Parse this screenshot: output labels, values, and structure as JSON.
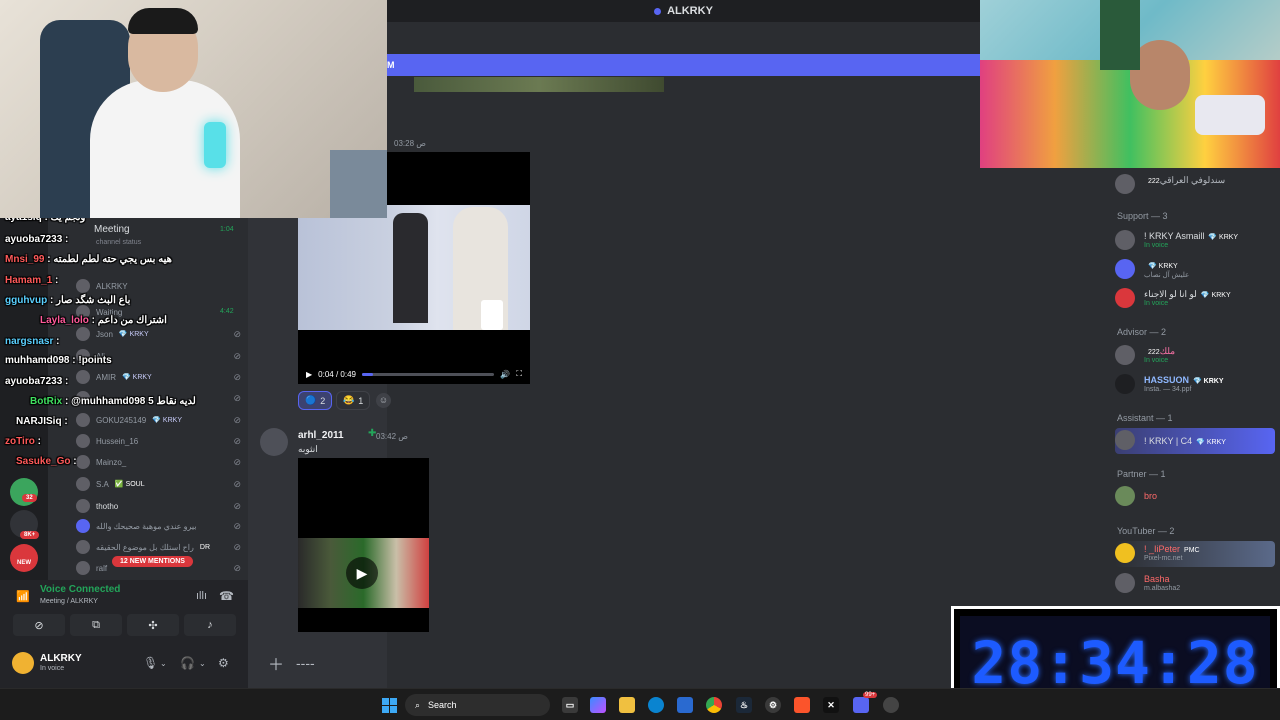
{
  "window": {
    "title": "ALKRKY"
  },
  "chat": {
    "banner_text": "M",
    "timestamp1": "03:28 ص",
    "video": {
      "time": "0:04 / 0:49",
      "progress": 0.08
    },
    "reactions": [
      {
        "emoji": "🔵",
        "count": "2",
        "active": true
      },
      {
        "emoji": "😂",
        "count": "1",
        "active": false
      }
    ],
    "message2": {
      "author": "arhl_2011",
      "timestamp": "03:42 ص",
      "text": "انثوبه"
    },
    "composer_placeholder": "----"
  },
  "sidebar": {
    "channel_title": "Meeting",
    "channel_status": "channel status",
    "channel_time": "1:04",
    "items": [
      {
        "name": "ALKRKY",
        "tag": ""
      },
      {
        "name": "Waiting",
        "tag": "",
        "time": "4:42"
      },
      {
        "name": "Json",
        "tag": "💎 KRKY"
      },
      {
        "name": "Ali",
        "tag": ""
      },
      {
        "name": "AMIR",
        "tag": "💎 KRKY"
      },
      {
        "name": "GOKU245149",
        "tag": "💎 KRKY"
      },
      {
        "name": "Hussein_16",
        "tag": ""
      },
      {
        "name": "Mainzo_",
        "tag": ""
      },
      {
        "name": "S.A",
        "tag": "✅ SOUL"
      },
      {
        "name": "thotho",
        "tag": ""
      },
      {
        "name": "بيرو عندي موهبة صحيحك والله",
        "tag": ""
      },
      {
        "name": "راح استلك بل موضوع الحقيقه",
        "tag": "DR"
      },
      {
        "name": "ralf",
        "tag": ""
      }
    ],
    "new_mentions": "12 NEW MENTIONS"
  },
  "servers": {
    "badges": [
      "32",
      "8K+",
      "NEW"
    ]
  },
  "overlay_chat": [
    {
      "user": "aya1siq",
      "text": "ونجم يك",
      "color": "#ffffff"
    },
    {
      "user": "ayuoba7233",
      "text": "",
      "color": "#ffffff"
    },
    {
      "user": "Mnsi_99",
      "text": "هيه بس يجي حته لطم لطمته",
      "color": "#ff5a5a"
    },
    {
      "user": "Hamam_1",
      "text": "",
      "color": "#ff5a5a"
    },
    {
      "user": "gguhvup",
      "text": "باع البث شگد صار",
      "color": "#ffffff"
    },
    {
      "user": "Layla_lolo",
      "text": "اشتراك من داعم",
      "color": "#ff5a9a"
    },
    {
      "user": "nargsnasr",
      "text": "",
      "color": "#5ad0ff"
    },
    {
      "user": "muhhamd098",
      "text": "!points",
      "color": "#ffffff"
    },
    {
      "user": "ayuoba7233",
      "text": "",
      "color": "#ffffff"
    },
    {
      "user": "BotRix",
      "text": "@muhhamd098 لديه نقاط 5",
      "color": "#40e060"
    },
    {
      "user": "NARJISiq",
      "text": "",
      "color": "#ffffff"
    },
    {
      "user": "zoTiro",
      "text": "",
      "color": "#ff5a5a"
    },
    {
      "user": "Sasuke_Go",
      "text": "",
      "color": "#ff5a5a"
    }
  ],
  "voice": {
    "status": "Voice Connected",
    "channel": "Meeting / ALKRKY"
  },
  "user": {
    "name": "ALKRKY",
    "status": "In voice"
  },
  "members": {
    "top_member": {
      "name": "سندلوفي العراقي",
      "tag": "222"
    },
    "groups": [
      {
        "label": "Support — 3",
        "members": [
          {
            "name": "! KRKY Asmaill",
            "tag": "💎 KRKY",
            "sub": "In voice"
          },
          {
            "name": "",
            "tag": "💎 KRKY",
            "sub": "عليش آل نصاب"
          },
          {
            "name": "لو انا لو الاجناء",
            "tag": "💎 KRKY",
            "sub": "In voice"
          }
        ]
      },
      {
        "label": "Advisor — 2",
        "members": [
          {
            "name": "ملك",
            "tag": "222",
            "sub": "In voice"
          },
          {
            "name": "HASSUON",
            "tag": "💎 KRKY",
            "sub": "Insta. — 34.ppf"
          }
        ]
      },
      {
        "label": "Assistant — 1",
        "members": [
          {
            "name": "! KRKY | C4",
            "tag": "💎 KRKY",
            "sub": ""
          }
        ]
      },
      {
        "label": "Partner — 1",
        "members": [
          {
            "name": "bro",
            "tag": "",
            "sub": ""
          }
        ]
      },
      {
        "label": "YouTuber — 2",
        "members": [
          {
            "name": "! _IiPeter",
            "tag": "PMC",
            "sub": "Pixel-mc.net"
          },
          {
            "name": "Basha",
            "tag": "",
            "sub": "m.albasha2"
          }
        ]
      }
    ]
  },
  "timer": {
    "text": "28:34:28"
  },
  "taskbar": {
    "search_label": "Search",
    "tray_badge": "99+"
  },
  "colors": {
    "accent": "#5865f2",
    "timer": "#1d5bff",
    "online": "#23a55a"
  }
}
